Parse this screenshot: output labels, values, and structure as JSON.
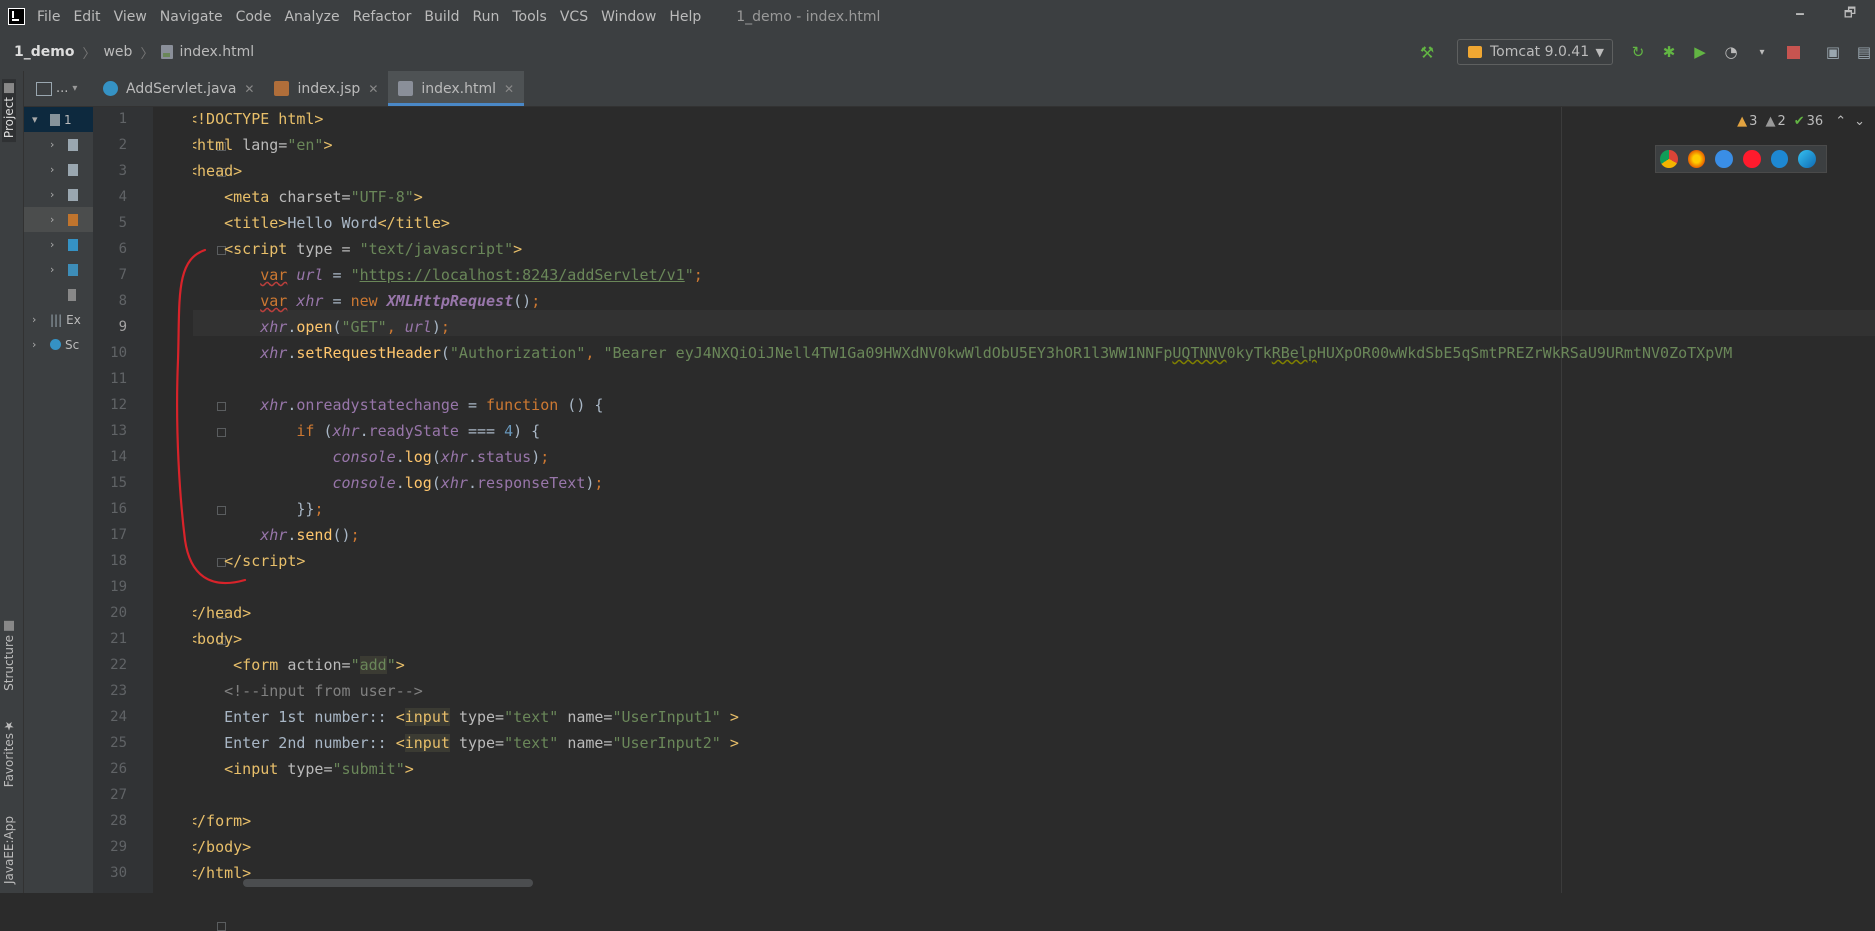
{
  "menubar": {
    "items": [
      "File",
      "Edit",
      "View",
      "Navigate",
      "Code",
      "Analyze",
      "Refactor",
      "Build",
      "Run",
      "Tools",
      "VCS",
      "Window",
      "Help"
    ],
    "window_title": "1_demo - index.html",
    "minimize": "🗕",
    "maximize": "🗗"
  },
  "breadcrumb": {
    "project": "1_demo",
    "folder": "web",
    "file": "index.html",
    "sep": "〉"
  },
  "toolbar": {
    "run_config": "Tomcat 9.0.41",
    "hammer_icon": "⚒"
  },
  "left_stripe": {
    "project": "Project",
    "structure": "Structure",
    "favorites": "Favorites",
    "javaee": "JavaEE:App"
  },
  "project_panel": {
    "header": "...",
    "root_label": "1",
    "external_label": "Ex",
    "scratches_label": "Sc"
  },
  "tabs": [
    {
      "label": "AddServlet.java",
      "kind": "java"
    },
    {
      "label": "index.jsp",
      "kind": "jsp"
    },
    {
      "label": "index.html",
      "kind": "html",
      "active": true
    }
  ],
  "inspections": {
    "warnings": "3",
    "weak_warnings": "2",
    "ok": "36"
  },
  "editor": {
    "current_line": 9,
    "line_numbers": [
      "1",
      "2",
      "3",
      "4",
      "5",
      "6",
      "7",
      "8",
      "9",
      "10",
      "11",
      "12",
      "13",
      "14",
      "15",
      "16",
      "17",
      "18",
      "19",
      "20",
      "21",
      "22",
      "23",
      "24",
      "25",
      "26",
      "27",
      "28",
      "29",
      "30"
    ]
  },
  "colors": {
    "accent": "#4a88c7",
    "annotation": "#d8232a",
    "warning": "#e2a340",
    "ok": "#62b543"
  }
}
